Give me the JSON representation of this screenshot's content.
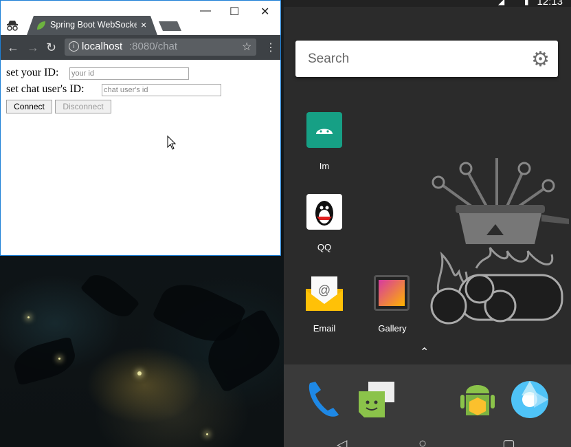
{
  "browser": {
    "tab_title": "Spring Boot WebSocket",
    "tab_close": "×",
    "window_minimize": "—",
    "window_maximize": "☐",
    "window_close": "✕",
    "url_host": "localhost",
    "url_path": ":8080/chat",
    "icons": [
      "incognito-icon",
      "back-icon",
      "forward-icon",
      "reload-icon",
      "info-icon",
      "star-icon",
      "menu-icon"
    ]
  },
  "page": {
    "your_id_label": "set your ID:",
    "your_id_placeholder": "your id",
    "chat_id_label": "set chat user's ID:",
    "chat_id_placeholder": "chat user's id",
    "connect_label": "Connect",
    "disconnect_label": "Disconnect"
  },
  "android": {
    "clock": "12:13",
    "search_placeholder": "Search",
    "apps": [
      {
        "label": "Im",
        "icon": "android-icon"
      },
      {
        "label": "QQ",
        "icon": "qq-penguin-icon"
      },
      {
        "label": "Email",
        "icon": "email-icon"
      },
      {
        "label": "Gallery",
        "icon": "gallery-icon"
      }
    ],
    "dock": [
      "phone-icon",
      "messaging-icon",
      "store-icon",
      "camera-icon"
    ],
    "nav": [
      "back-icon",
      "home-icon",
      "recents-icon"
    ]
  }
}
